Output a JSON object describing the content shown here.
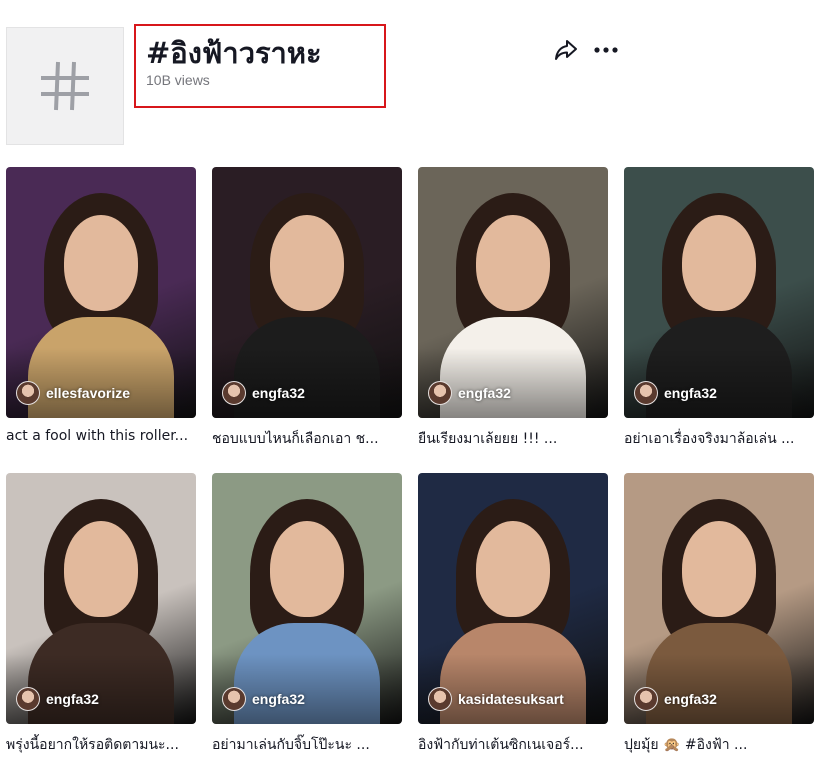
{
  "hashtag": {
    "title": "#อิงฟ้าวราหะ",
    "views": "10B views",
    "cover_icon": "hashtag-icon"
  },
  "actions": {
    "share_icon": "share-icon",
    "more_icon": "more-dots-icon"
  },
  "videos": [
    {
      "username": "ellesfavorize",
      "caption": "act a fool with this roller...",
      "bg": "#4a2a55",
      "accent": "#c9a36a"
    },
    {
      "username": "engfa32",
      "caption": "ชอบแบบไหนก็เลือกเอา ช...",
      "bg": "#2a1d24",
      "accent": "#1c1c1c"
    },
    {
      "username": "engfa32",
      "caption": "ยืนเรียงมาเล้ยยย !!! ...",
      "bg": "#6b6559",
      "accent": "#f4f0ea"
    },
    {
      "username": "engfa32",
      "caption": "อย่าเอาเรื่องจริงมาล้อเล่น ...",
      "bg": "#3c4e4b",
      "accent": "#1e1e1e"
    },
    {
      "username": "engfa32",
      "caption": "พรุ่งนี้อยากให้รอติดตามนะ...",
      "bg": "#c9c2bd",
      "accent": "#3d2b24"
    },
    {
      "username": "engfa32",
      "caption": "อย่ามาเล่นกับจิ๊บโป๊ะนะ ...",
      "bg": "#8c9a84",
      "accent": "#6d93c2"
    },
    {
      "username": "kasidatesuksart",
      "caption": "อิงฟ้ากับท่าเต้นซิกเนเจอร์...",
      "bg": "#1f2a44",
      "accent": "#b8866a"
    },
    {
      "username": "engfa32",
      "caption": "ปุยมุ้ย 🙊 #อิงฟ้า ...",
      "bg": "#b59a84",
      "accent": "#7b5a3e"
    }
  ]
}
